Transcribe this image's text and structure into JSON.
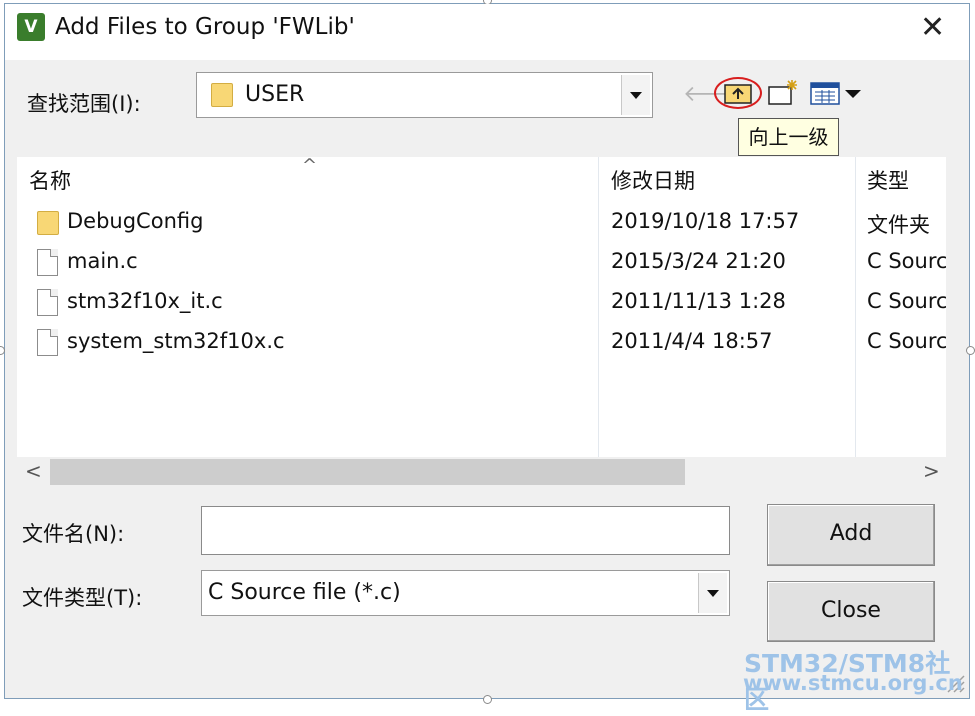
{
  "window": {
    "title": "Add Files to Group 'FWLib'",
    "app_icon_text": "V",
    "close_symbol": "✕"
  },
  "look_in": {
    "label": "查找范围(I):",
    "value": "USER"
  },
  "toolbar": {
    "back_symbol": "🡐",
    "up_one_level_tooltip": "向上一级"
  },
  "file_list": {
    "columns": [
      "名称",
      "修改日期",
      "类型"
    ],
    "sort_indicator": "^",
    "rows": [
      {
        "name": "DebugConfig",
        "date": "2019/10/18 17:57",
        "type": "文件夹",
        "icon": "folder-icon"
      },
      {
        "name": "main.c",
        "date": "2015/3/24 21:20",
        "type": "C Source",
        "icon": "file-icon"
      },
      {
        "name": "stm32f10x_it.c",
        "date": "2011/11/13 1:28",
        "type": "C Source",
        "icon": "file-icon"
      },
      {
        "name": "system_stm32f10x.c",
        "date": "2011/4/4 18:57",
        "type": "C Source",
        "icon": "file-icon"
      }
    ]
  },
  "scrollbar": {
    "left_arrow": "<",
    "right_arrow": ">"
  },
  "file_name": {
    "label": "文件名(N):",
    "value": ""
  },
  "file_type": {
    "label": "文件类型(T):",
    "value": "C Source file (*.c)"
  },
  "buttons": {
    "add": "Add",
    "close": "Close"
  },
  "watermark": {
    "line1": "STM32/STM8社区",
    "line2": "www.stmcu.org.cn"
  },
  "colors": {
    "highlight_circle": "#d81e1e",
    "folder": "#f8d775",
    "tooltip_bg": "#ffffe1"
  }
}
